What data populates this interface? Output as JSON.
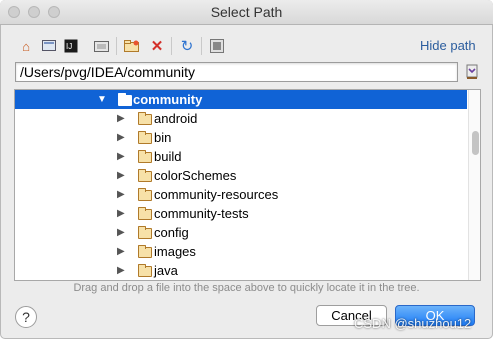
{
  "window": {
    "title": "Select Path"
  },
  "toolbar": {
    "icons": [
      "home-icon",
      "desktop-icon",
      "project-icon",
      "module-icon",
      "new-folder-icon",
      "delete-icon",
      "refresh-icon",
      "show-hidden-icon"
    ],
    "hide_path_label": "Hide path"
  },
  "path": {
    "value": "/Users/pvg/IDEA/community"
  },
  "tree": {
    "selected": "community",
    "children": [
      "android",
      "bin",
      "build",
      "colorSchemes",
      "community-resources",
      "community-tests",
      "config",
      "images",
      "java"
    ]
  },
  "hint": "Drag and drop a file into the space above to quickly locate it in the tree.",
  "footer": {
    "help_label": "?",
    "cancel_label": "Cancel",
    "ok_label": "OK"
  },
  "watermark": "CSDN @shuzhou12",
  "colors": {
    "selection": "#1063d6",
    "link": "#2b5d9e",
    "ok_button": "#1e7cf6"
  }
}
